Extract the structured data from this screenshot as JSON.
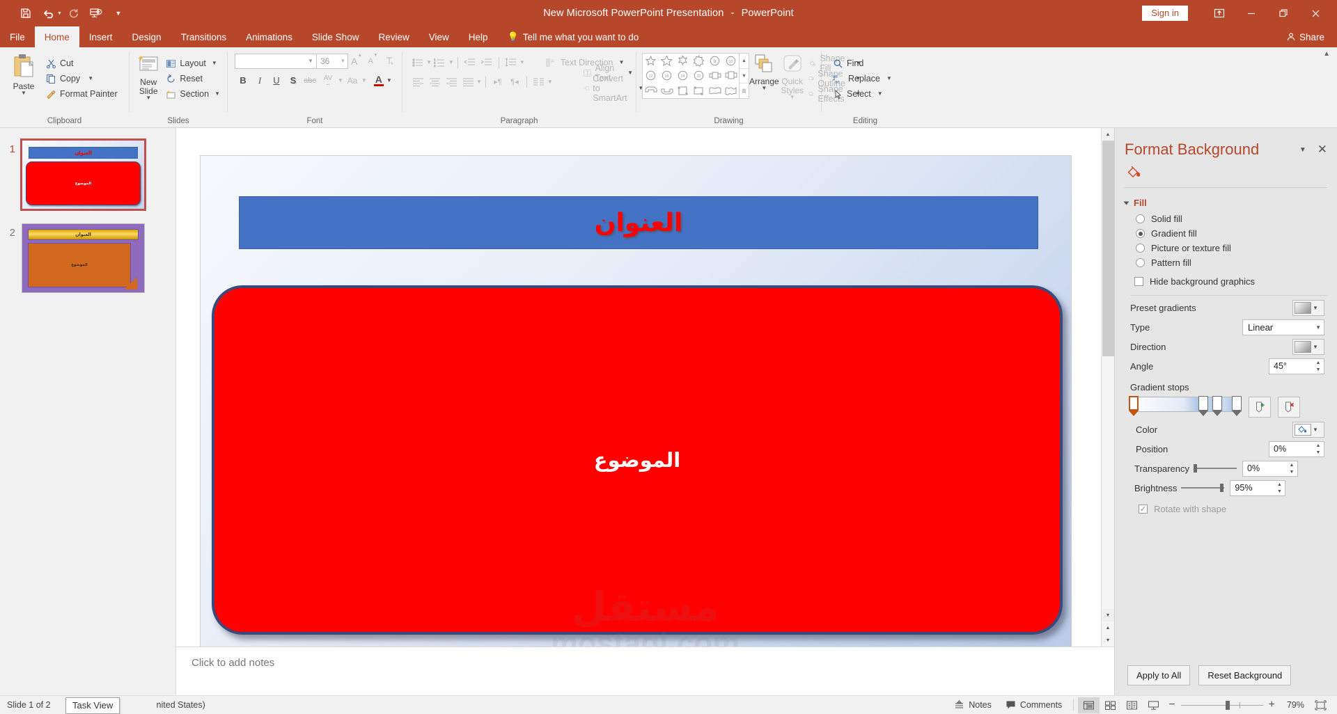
{
  "titlebar": {
    "document_title": "New Microsoft PowerPoint Presentation",
    "separator": "-",
    "app_name": "PowerPoint",
    "sign_in": "Sign in",
    "qat": [
      {
        "name": "save-icon",
        "label": "Save"
      },
      {
        "name": "undo-icon",
        "label": "Undo"
      },
      {
        "name": "redo-icon",
        "label": "Redo"
      },
      {
        "name": "start-slideshow-icon",
        "label": "Start From Beginning"
      },
      {
        "name": "customize-qat-icon",
        "label": "Customize Quick Access Toolbar"
      }
    ],
    "window_buttons": [
      "ribbon-display-options",
      "minimize",
      "restore",
      "close"
    ]
  },
  "tabs": [
    {
      "label": "File",
      "active": false
    },
    {
      "label": "Home",
      "active": true
    },
    {
      "label": "Insert",
      "active": false
    },
    {
      "label": "Design",
      "active": false
    },
    {
      "label": "Transitions",
      "active": false
    },
    {
      "label": "Animations",
      "active": false
    },
    {
      "label": "Slide Show",
      "active": false
    },
    {
      "label": "Review",
      "active": false
    },
    {
      "label": "View",
      "active": false
    },
    {
      "label": "Help",
      "active": false
    }
  ],
  "tellme": "Tell me what you want to do",
  "share": "Share",
  "ribbon": {
    "clipboard": {
      "group_label": "Clipboard",
      "paste": "Paste",
      "cut": "Cut",
      "copy": "Copy",
      "format_painter": "Format Painter"
    },
    "slides": {
      "group_label": "Slides",
      "new_slide": "New Slide",
      "layout": "Layout",
      "reset": "Reset",
      "section": "Section"
    },
    "font": {
      "group_label": "Font",
      "font_name": "",
      "font_size": "36",
      "bold": "B",
      "italic": "I",
      "underline": "U",
      "shadow": "S",
      "strikethrough": "abc",
      "char_spacing": "AV",
      "change_case": "Aa",
      "font_color": "A",
      "grow_font": "A",
      "shrink_font": "A",
      "clear_formatting": "clear-formatting-icon"
    },
    "paragraph": {
      "group_label": "Paragraph",
      "text_direction": "Text Direction",
      "align_text": "Align Text",
      "convert_to_smartart": "Convert to SmartArt"
    },
    "drawing": {
      "group_label": "Drawing",
      "arrange": "Arrange",
      "quick_styles": "Quick Styles",
      "shape_fill": "Shape Fill",
      "shape_outline": "Shape Outline",
      "shape_effects": "Shape Effects",
      "shapes": [
        "star-5-point",
        "star-5-point-outline",
        "star-6-point",
        "star-7-point",
        "star-8-point",
        "star-10-point",
        "star-12-point",
        "star-16-point",
        "star-24-point",
        "star-32-point",
        "ribbon-up",
        "ribbon-down",
        "ribbon-curved-down",
        "ribbon-curved-up",
        "scroll-vertical",
        "scroll-horizontal",
        "wave",
        "double-wave"
      ]
    },
    "editing": {
      "group_label": "Editing",
      "find": "Find",
      "replace": "Replace",
      "select": "Select"
    }
  },
  "thumbnails": [
    {
      "number": "1",
      "selected": true,
      "title": "العنوان",
      "body": "الموضوع"
    },
    {
      "number": "2",
      "selected": false,
      "title": "العنوان",
      "body": "الموضوع"
    }
  ],
  "slide": {
    "title": "العنوان",
    "body": "الموضوع",
    "title_color": "#ff0000",
    "title_box_color": "#4472c4",
    "body_box_color": "#ff0000",
    "body_border_color": "#3b4a7a"
  },
  "watermark": {
    "arabic": "مستقل",
    "latin": "mostaql.com"
  },
  "notes_placeholder": "Click to add notes",
  "pane": {
    "title": "Format Background",
    "fill_section": "Fill",
    "options": [
      {
        "label": "Solid fill",
        "selected": false
      },
      {
        "label": "Gradient fill",
        "selected": true
      },
      {
        "label": "Picture or texture fill",
        "selected": false
      },
      {
        "label": "Pattern fill",
        "selected": false
      }
    ],
    "hide_background_graphics": {
      "label": "Hide background graphics",
      "checked": false
    },
    "preset_gradients_label": "Preset gradients",
    "type_label": "Type",
    "type_value": "Linear",
    "direction_label": "Direction",
    "angle_label": "Angle",
    "angle_value": "45°",
    "gradient_stops_label": "Gradient stops",
    "add_stop": "add-gradient-stop-icon",
    "remove_stop": "remove-gradient-stop-icon",
    "color_label": "Color",
    "position_label": "Position",
    "position_value": "0%",
    "transparency_label": "Transparency",
    "transparency_value": "0%",
    "brightness_label": "Brightness",
    "brightness_value": "95%",
    "rotate_with_shape": {
      "label": "Rotate with shape",
      "checked": true
    },
    "apply_to_all": "Apply to All",
    "reset_background": "Reset Background"
  },
  "status": {
    "slide_count": "Slide 1 of 2",
    "language": "nited States)",
    "tooltip": "Task View",
    "notes": "Notes",
    "comments": "Comments",
    "zoom_percent": "79%",
    "views": [
      "normal-view",
      "slide-sorter-view",
      "reading-view",
      "slide-show-view"
    ],
    "fit_to_window": "fit-slide-to-window-icon"
  }
}
